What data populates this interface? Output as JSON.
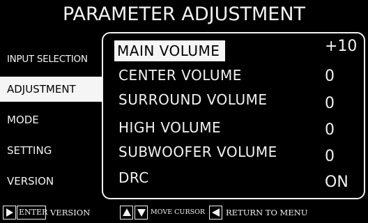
{
  "title": "PARAMETER ADJUSTMENT",
  "sidebar": {
    "items": [
      {
        "label": "INPUT SELECTION",
        "active": false
      },
      {
        "label": "ADJUSTMENT",
        "active": true
      },
      {
        "label": "MODE",
        "active": false
      },
      {
        "label": "SETTING",
        "active": false
      },
      {
        "label": "VERSION",
        "active": false
      }
    ]
  },
  "parameters": [
    {
      "label": "MAIN VOLUME",
      "value": "+10",
      "selected": true
    },
    {
      "label": "CENTER VOLUME",
      "value": "0",
      "selected": false
    },
    {
      "label": "SURROUND VOLUME",
      "value": "0",
      "selected": false
    },
    {
      "label": "HIGH VOLUME",
      "value": "0",
      "selected": false
    },
    {
      "label": "SUBWOOFER VOLUME",
      "value": "0",
      "selected": false
    },
    {
      "label": "DRC",
      "value": "ON",
      "selected": false
    }
  ],
  "footer": {
    "enter_key": "ENTER",
    "enter_action": "VERSION",
    "move_action": "MOVE CURSOR",
    "return_action": "RETURN TO MENU",
    "icons": [
      "play-right-icon",
      "arrow-up-icon",
      "arrow-down-icon",
      "arrow-left-icon"
    ]
  },
  "colors": {
    "background": "#000000",
    "foreground": "#f2f2f2",
    "highlight": "#f5f5f5"
  }
}
